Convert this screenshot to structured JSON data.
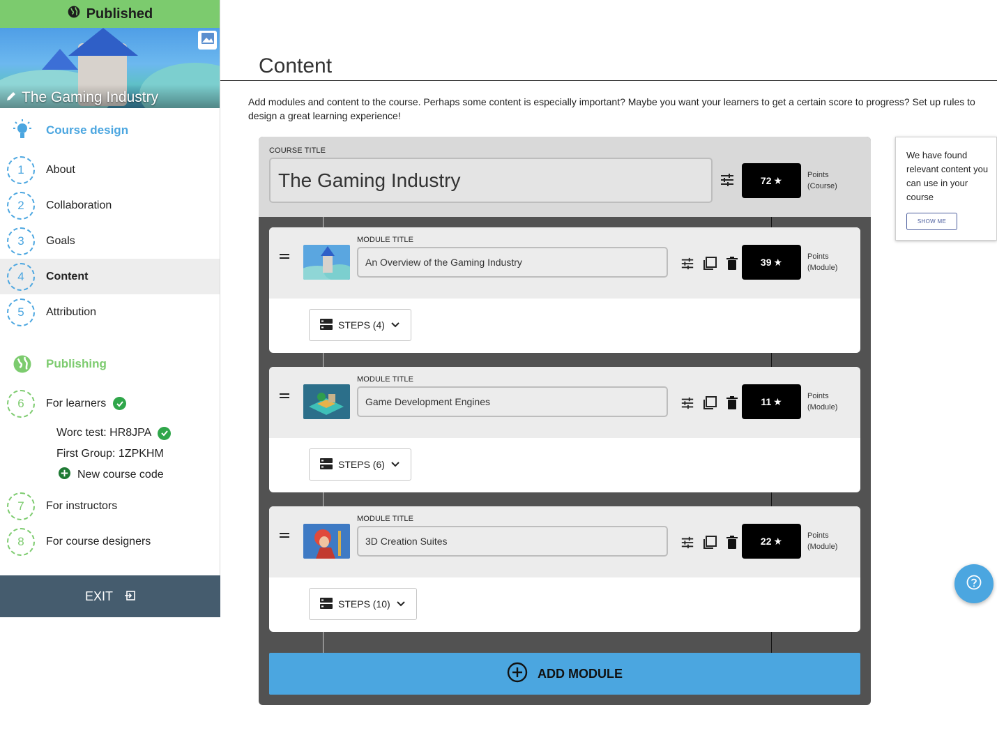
{
  "sidebar": {
    "status": "Published",
    "course_title": "The Gaming Industry",
    "course_design_label": "Course design",
    "design_steps": [
      {
        "number": "1",
        "label": "About"
      },
      {
        "number": "2",
        "label": "Collaboration"
      },
      {
        "number": "3",
        "label": "Goals"
      },
      {
        "number": "4",
        "label": "Content"
      },
      {
        "number": "5",
        "label": "Attribution"
      }
    ],
    "publishing_label": "Publishing",
    "publish_steps": [
      {
        "number": "6",
        "label": "For learners"
      },
      {
        "number": "7",
        "label": "For instructors"
      },
      {
        "number": "8",
        "label": "For course designers"
      }
    ],
    "learner_codes": [
      {
        "label": "Worc test: HR8JPA"
      },
      {
        "label": "First Group: 1ZPKHM"
      }
    ],
    "new_code_label": "New course code",
    "exit_label": "EXIT"
  },
  "main": {
    "title": "Content",
    "intro": "Add modules and content to the course. Perhaps some content is especially important? Maybe you want your learners to get a certain score to progress? Set up rules to design a great learning experience!",
    "course": {
      "title_label": "COURSE TITLE",
      "title": "The Gaming Industry",
      "points": "72",
      "points_label": "Points",
      "points_scope": "(Course)"
    },
    "modules": [
      {
        "title_label": "MODULE TITLE",
        "title": "An Overview of the Gaming Industry",
        "points": "39",
        "points_label": "Points",
        "points_scope": "(Module)",
        "steps": "STEPS (4)"
      },
      {
        "title_label": "MODULE TITLE",
        "title": "Game Development Engines",
        "points": "11",
        "points_label": "Points",
        "points_scope": "(Module)",
        "steps": "STEPS (6)"
      },
      {
        "title_label": "MODULE TITLE",
        "title": "3D Creation Suites",
        "points": "22",
        "points_label": "Points",
        "points_scope": "(Module)",
        "steps": "STEPS (10)"
      }
    ],
    "add_module_label": "ADD MODULE"
  },
  "tip": {
    "text": "We have found relevant content you can use in your course",
    "button": "SHOW ME"
  },
  "colors": {
    "published_green": "#7ccb6e",
    "accent_blue": "#4ba6e0",
    "exit_bar": "#455c6e",
    "builder_bg": "#525252"
  }
}
